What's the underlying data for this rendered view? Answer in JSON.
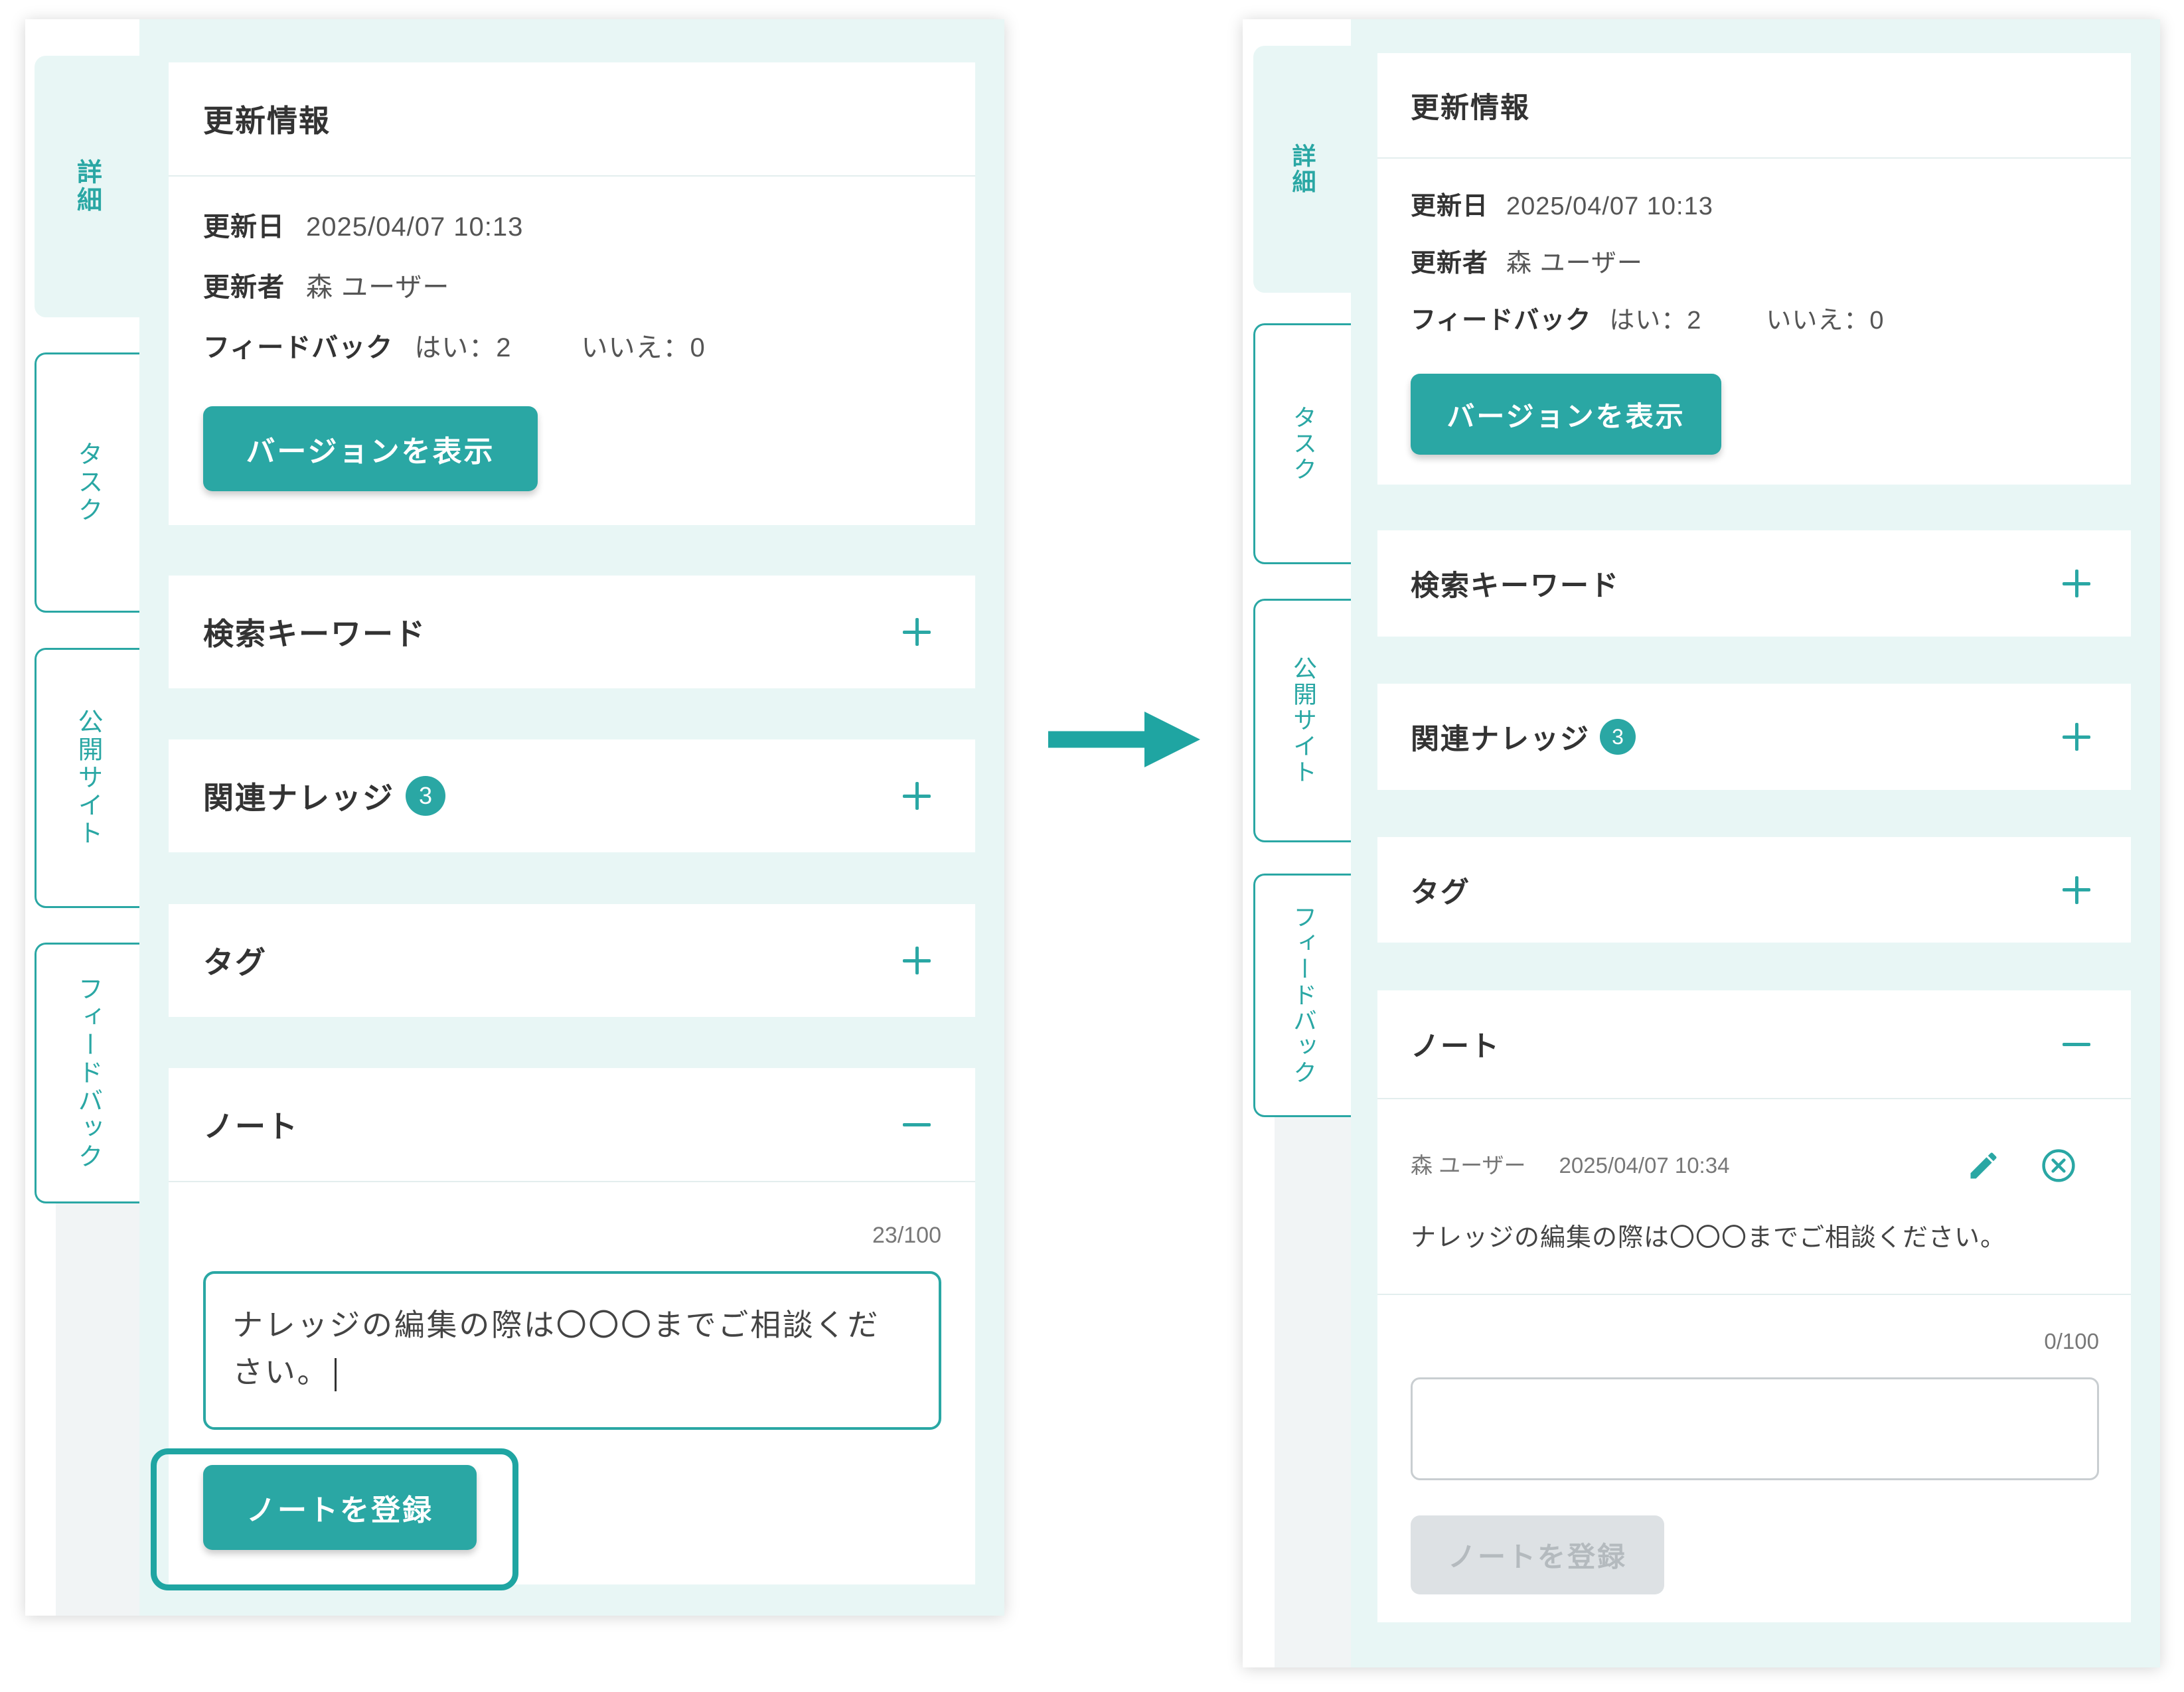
{
  "before": {
    "tabs": [
      {
        "label": "詳細",
        "active": true
      },
      {
        "label": "タスク",
        "active": false
      },
      {
        "label": "公開サイト",
        "active": false
      },
      {
        "label": "フィードバック",
        "active": false
      }
    ],
    "update_info": {
      "title": "更新情報",
      "updated_date_label": "更新日",
      "updated_date": "2025/04/07 10:13",
      "updated_by_label": "更新者",
      "updated_by": "森 ユーザー",
      "feedback_label": "フィードバック",
      "feedback_yes": "はい：2",
      "feedback_no": "いいえ：0",
      "version_button": "バージョンを表示"
    },
    "keywords": {
      "title": "検索キーワード",
      "icon": "plus-icon"
    },
    "related_knowledge": {
      "title": "関連ナレッジ",
      "count": 3,
      "icon": "plus-icon"
    },
    "tags": {
      "title": "タグ",
      "icon": "plus-icon"
    },
    "note": {
      "title": "ノート",
      "icon": "minus-icon",
      "char_counter": "23/100",
      "input_value": "ナレッジの編集の際は〇〇〇までご相談ください。",
      "submit_button": "ノートを登録",
      "submit_enabled": true,
      "submit_highlighted": true
    }
  },
  "transition_arrow": {
    "icon": "arrow-right-icon"
  },
  "after": {
    "tabs": [
      {
        "label": "詳細",
        "active": true
      },
      {
        "label": "タスク",
        "active": false
      },
      {
        "label": "公開サイト",
        "active": false
      },
      {
        "label": "フィードバック",
        "active": false
      }
    ],
    "update_info": {
      "title": "更新情報",
      "updated_date_label": "更新日",
      "updated_date": "2025/04/07 10:13",
      "updated_by_label": "更新者",
      "updated_by": "森 ユーザー",
      "feedback_label": "フィードバック",
      "feedback_yes": "はい：2",
      "feedback_no": "いいえ：0",
      "version_button": "バージョンを表示"
    },
    "keywords": {
      "title": "検索キーワード",
      "icon": "plus-icon"
    },
    "related_knowledge": {
      "title": "関連ナレッジ",
      "count": 3,
      "icon": "plus-icon"
    },
    "tags": {
      "title": "タグ",
      "icon": "plus-icon"
    },
    "note": {
      "title": "ノート",
      "icon": "minus-icon",
      "entries": [
        {
          "author": "森 ユーザー",
          "timestamp": "2025/04/07 10:34",
          "text": "ナレッジの編集の際は〇〇〇までご相談ください。",
          "edit_icon": "pencil-icon",
          "delete_icon": "close-circle-icon"
        }
      ],
      "char_counter": "0/100",
      "input_value": "",
      "submit_button": "ノートを登録",
      "submit_enabled": false
    }
  },
  "colors": {
    "accent": "#2aa7a4",
    "panel_background": "#e8f6f5",
    "highlight_border": "#1fa5a2",
    "disabled_button_background": "#dde1e4",
    "disabled_button_text": "#b4babe"
  }
}
